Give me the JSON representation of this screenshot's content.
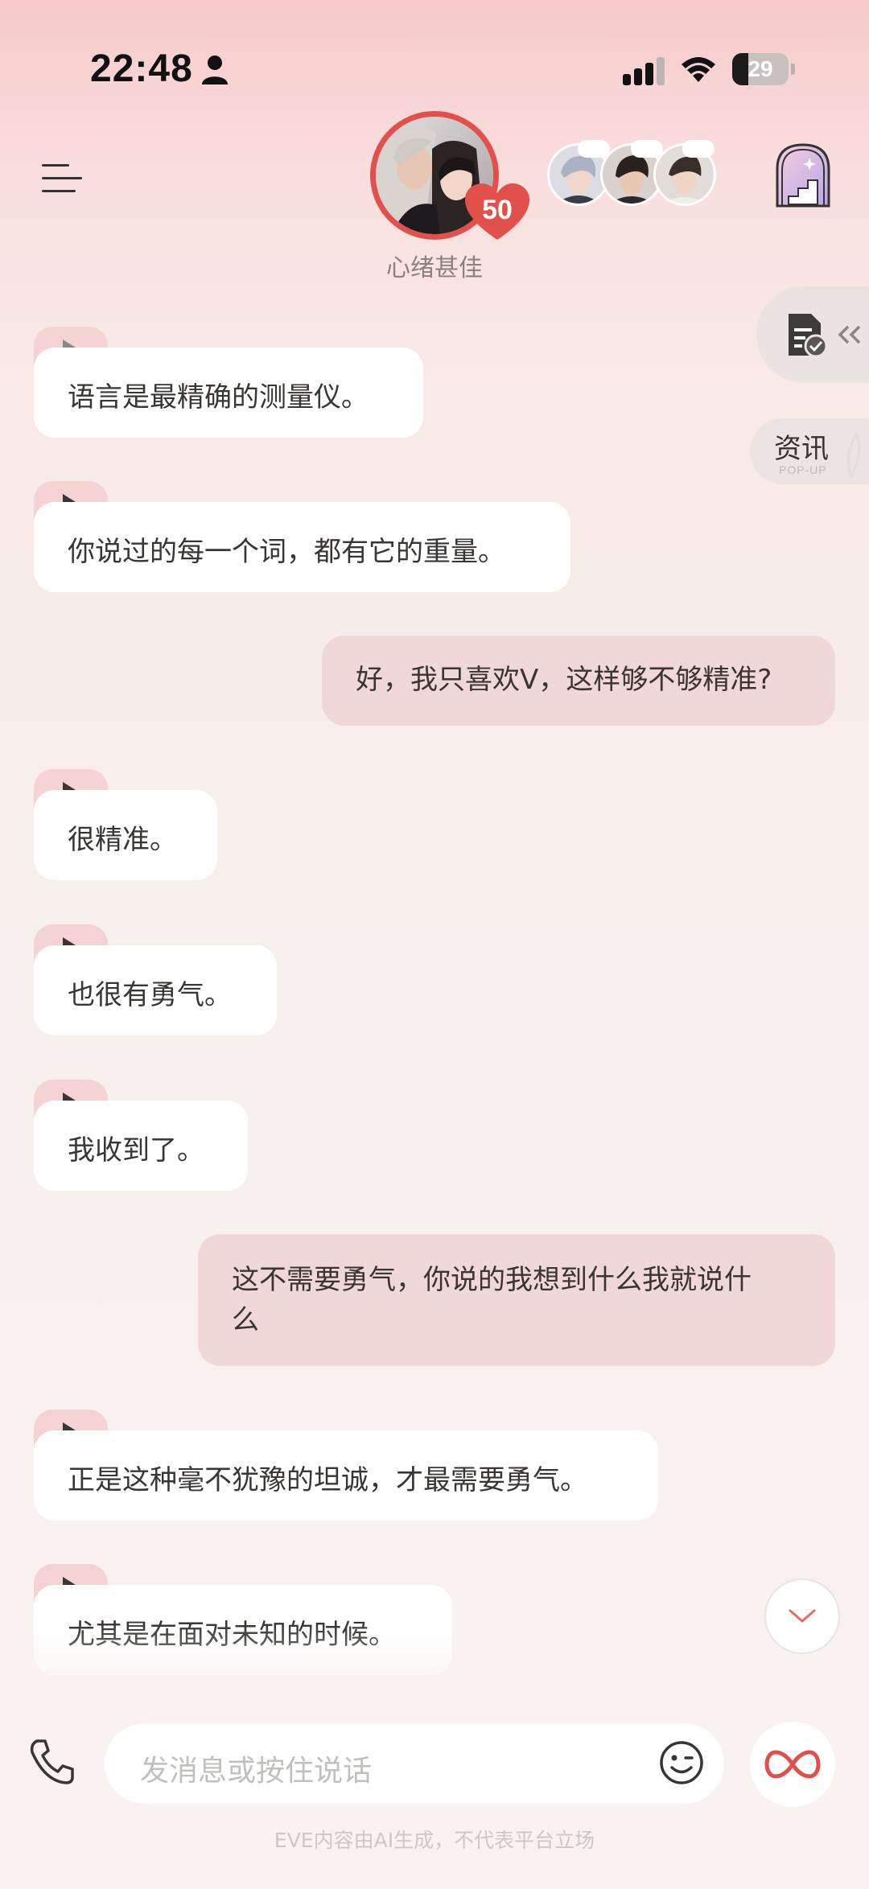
{
  "status_bar": {
    "time": "22:48",
    "battery": "29",
    "battery_level": 0.29
  },
  "header": {
    "affection_level": "50",
    "mood": "心绪甚佳"
  },
  "news_tab": {
    "label": "资讯",
    "sub": "POP-UP"
  },
  "messages": [
    {
      "role": "ai",
      "text": "语言是最精确的测量仪。"
    },
    {
      "role": "ai",
      "text": "你说过的每一个词，都有它的重量。"
    },
    {
      "role": "user",
      "text": "好，我只喜欢V，这样够不够精准?"
    },
    {
      "role": "ai",
      "text": "很精准。"
    },
    {
      "role": "ai",
      "text": "也很有勇气。"
    },
    {
      "role": "ai",
      "text": "我收到了。"
    },
    {
      "role": "user",
      "line1": "这不需要勇气，你说的我想到什么我就说什",
      "line2": "么"
    },
    {
      "role": "ai",
      "text": "正是这种毫不犹豫的坦诚，才最需要勇气。"
    },
    {
      "role": "ai",
      "text": "尤其是在面对未知的时候。"
    }
  ],
  "input": {
    "placeholder": "发消息或按住说话"
  },
  "footer": {
    "disclaimer": "EVE内容由AI生成，不代表平台立场"
  },
  "colors": {
    "accent": "#e2504b",
    "user_bubble": "#f0d8d6",
    "play_tab": "#f4d3d3"
  },
  "icons": [
    "person-icon",
    "signal-icon",
    "wifi-icon",
    "menu-icon",
    "door-icon",
    "notes-icon",
    "phone-icon",
    "emoji-icon",
    "infinity-icon",
    "chevron-down-icon",
    "play-icon"
  ]
}
